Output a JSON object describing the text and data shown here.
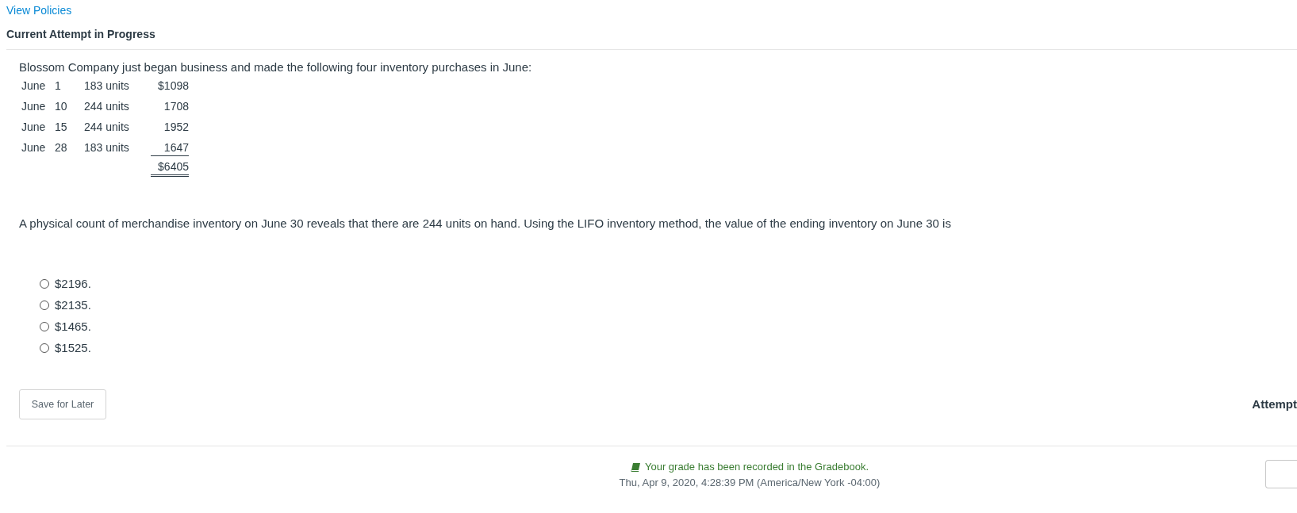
{
  "header": {
    "link": "View Policies",
    "title": "Current Attempt in Progress"
  },
  "question": {
    "intro": "Blossom Company just began business and made the following four inventory purchases in June:",
    "purchases": [
      {
        "month": "June",
        "day": "1",
        "units": "183 units",
        "amount": "$1098"
      },
      {
        "month": "June",
        "day": "10",
        "units": "244 units",
        "amount": "1708"
      },
      {
        "month": "June",
        "day": "15",
        "units": "244 units",
        "amount": "1952"
      },
      {
        "month": "June",
        "day": "28",
        "units": "183 units",
        "amount": "1647"
      }
    ],
    "total": "$6405",
    "prompt": "A physical count of merchandise inventory on June 30 reveals that there are 244 units on hand. Using the LIFO inventory method, the value of the ending inventory on June 30 is",
    "options": [
      {
        "label": "$2196.",
        "selected": false
      },
      {
        "label": "$2135.",
        "selected": false
      },
      {
        "label": "$1465.",
        "selected": false
      },
      {
        "label": "$1525.",
        "selected": false
      }
    ]
  },
  "actions": {
    "save_button": "Save for Later",
    "attempts_label": "Attempt"
  },
  "footer": {
    "notice": "Your grade has been recorded in the Gradebook.",
    "timestamp": "Thu, Apr 9, 2020, 4:28:39 PM (America/New York -04:00)"
  }
}
